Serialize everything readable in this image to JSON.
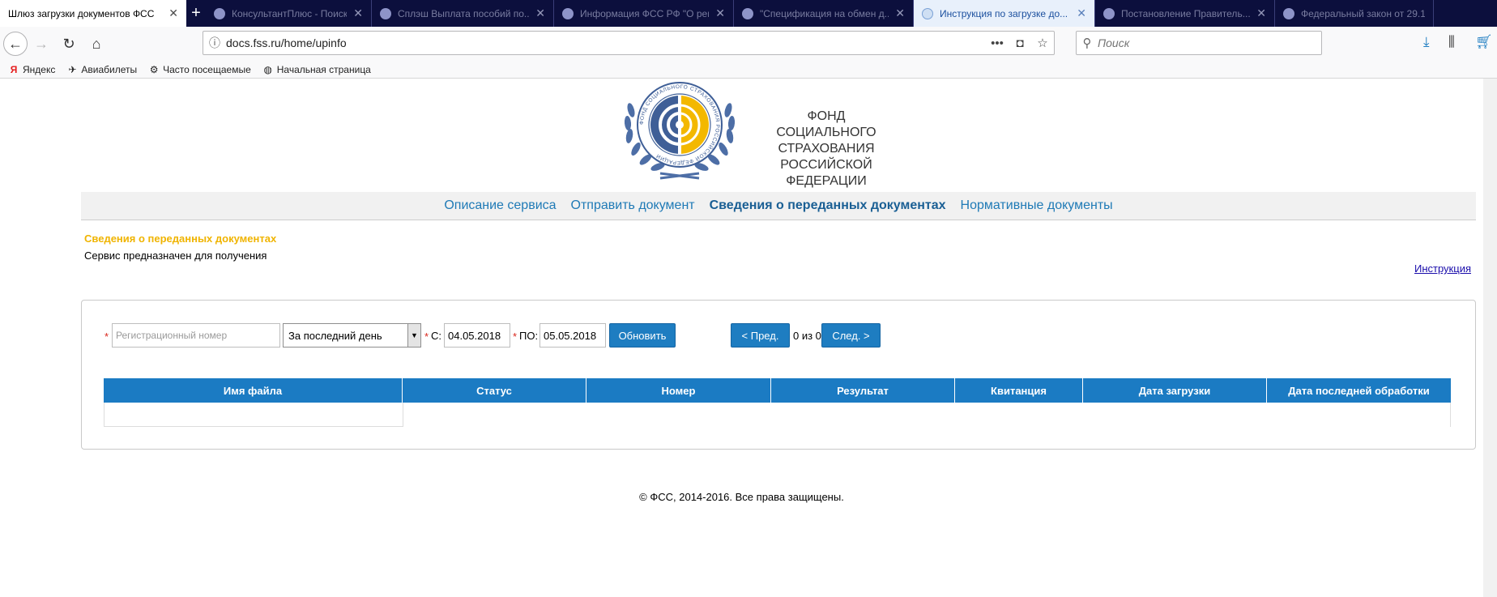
{
  "browser": {
    "tabs": [
      {
        "title": "Шлюз загрузки документов ФСС",
        "active": true
      },
      {
        "title": "КонсультантПлюс - Поиск п...",
        "active": false
      },
      {
        "title": "Сплэш Выплата пособий по...",
        "active": false
      },
      {
        "title": "Информация ФСС РФ \"О реги...",
        "active": false
      },
      {
        "title": "\"Спецификация на обмен д...",
        "active": false
      },
      {
        "title": "Инструкция по загрузке до...",
        "active": false
      },
      {
        "title": "Постановление Правитель...",
        "active": false
      },
      {
        "title": "Федеральный закон от 29.1...",
        "active": false
      }
    ],
    "url": "docs.fss.ru/home/upinfo",
    "search_placeholder": "Поиск",
    "bookmarks": [
      "Яндекс",
      "Авиабилеты",
      "Часто посещаемые",
      "Начальная страница"
    ]
  },
  "header": {
    "org_line1": "ФОНД",
    "org_line2": "СОЦИАЛЬНОГО СТРАХОВАНИЯ",
    "org_line3": "РОССИЙСКОЙ ФЕДЕРАЦИИ",
    "logo_ring_text": "ФОНД СОЦИАЛЬНОГО СТРАХОВАНИЯ РОССИЙСКОЙ ФЕДЕРАЦИИ"
  },
  "menu": {
    "items": [
      {
        "label": "Описание сервиса",
        "current": false
      },
      {
        "label": "Отправить документ",
        "current": false
      },
      {
        "label": "Сведения о переданных документах",
        "current": true
      },
      {
        "label": "Нормативные документы",
        "current": false
      }
    ]
  },
  "page": {
    "title": "Сведения о переданных документах",
    "description": "Сервис предназначен для получения",
    "instruction_link": "Инструкция"
  },
  "filter": {
    "req_mark": "*",
    "regnum_placeholder": "Регистрационный номер",
    "period_value": "За последний день",
    "from_label": "С:",
    "from_value": "04.05.2018",
    "to_label": "ПО:",
    "to_value": "05.05.2018",
    "refresh_label": "Обновить",
    "prev_label": "< Пред.",
    "pager_text": "0 из 0",
    "next_label": "След. >"
  },
  "table": {
    "columns": [
      "Имя файла",
      "Статус",
      "Номер",
      "Результат",
      "Квитанция",
      "Дата загрузки",
      "Дата последней обработки"
    ],
    "rows": []
  },
  "footer": {
    "copyright": "© ФСС, 2014-2016. Все права защищены."
  },
  "colors": {
    "tab_bg": "#0c0f3d",
    "accent_blue": "#1b7bc3",
    "title_yellow": "#f0b400",
    "link_blue": "#1f7ab6"
  }
}
